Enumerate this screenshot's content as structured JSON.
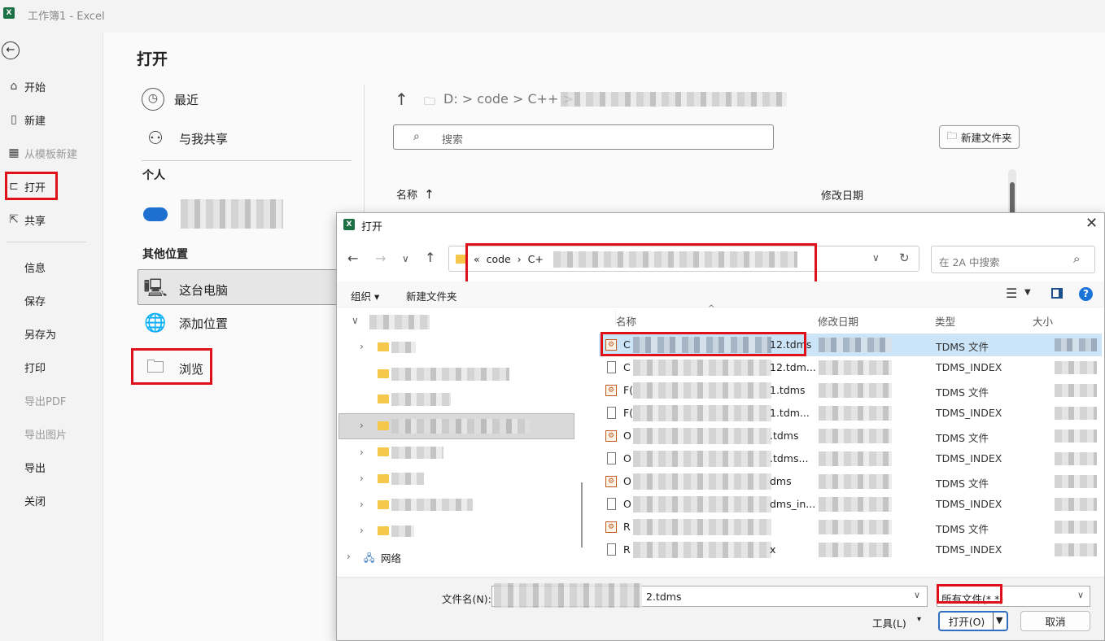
{
  "app": {
    "logo_letter": "X",
    "title": "工作簿1  -  Excel"
  },
  "rail": {
    "back_glyph": "←",
    "items": [
      {
        "label": "开始",
        "icon": "home-icon"
      },
      {
        "label": "新建",
        "icon": "new-doc-icon"
      },
      {
        "label": "从模板新建",
        "icon": "template-icon"
      },
      {
        "label": "打开",
        "icon": "open-folder-icon"
      },
      {
        "label": "共享",
        "icon": "share-icon"
      }
    ],
    "text_items": [
      "信息",
      "保存",
      "另存为",
      "打印",
      "导出PDF",
      "导出图片",
      "导出",
      "关闭"
    ]
  },
  "open_page": {
    "title": "打开",
    "recent_label": "最近",
    "shared_label": "与我共享",
    "personal_header": "个人",
    "other_header": "其他位置",
    "this_pc_label": "这台电脑",
    "add_location_label": "添加位置",
    "browse_label": "浏览",
    "path": "D: > code > C++ >",
    "search_placeholder": "搜索",
    "new_folder_label": "新建文件夹",
    "col_name": "名称",
    "col_modified": "修改日期"
  },
  "dialog": {
    "title": "打开",
    "address": "«  code  ›  C+",
    "search_placeholder": "在 2A 中搜索",
    "organize_label": "组织 ▾",
    "new_folder_label": "新建文件夹",
    "network_label": "网络",
    "columns": {
      "name": "名称",
      "modified": "修改日期",
      "type": "类型",
      "size": "大小"
    },
    "files": [
      {
        "prefix": "C",
        "suffix": "12.tdms",
        "type": "TDMS 文件",
        "kind": "tdms",
        "selected": true
      },
      {
        "prefix": "C",
        "suffix": "12.tdm...",
        "type": "TDMS_INDEX",
        "kind": "index",
        "selected": false
      },
      {
        "prefix": "F(",
        "suffix": "1.tdms",
        "type": "TDMS 文件",
        "kind": "tdms",
        "selected": false
      },
      {
        "prefix": "F(",
        "suffix": "1.tdm...",
        "type": "TDMS_INDEX",
        "kind": "index",
        "selected": false
      },
      {
        "prefix": "O",
        "suffix": ".tdms",
        "type": "TDMS 文件",
        "kind": "tdms",
        "selected": false
      },
      {
        "prefix": "O",
        "suffix": ".tdms...",
        "type": "TDMS_INDEX",
        "kind": "index",
        "selected": false
      },
      {
        "prefix": "O",
        "suffix": "dms",
        "type": "TDMS 文件",
        "kind": "tdms",
        "selected": false
      },
      {
        "prefix": "O",
        "suffix": "dms_in...",
        "type": "TDMS_INDEX",
        "kind": "index",
        "selected": false
      },
      {
        "prefix": "R",
        "suffix": "",
        "type": "TDMS 文件",
        "kind": "tdms",
        "selected": false
      },
      {
        "prefix": "R",
        "suffix": "x",
        "type": "TDMS_INDEX",
        "kind": "index",
        "selected": false
      }
    ],
    "filename_label": "文件名(N):",
    "filename_value": "2.tdms",
    "filetype_value": "所有文件(*.*)",
    "tools_label": "工具(L)",
    "open_button": "打开(O)",
    "cancel_button": "取消"
  },
  "colors": {
    "accent_red": "#e0101a",
    "excel_green": "#1d7044",
    "folder_yellow": "#f5c84c",
    "selection_blue": "#cce4f7"
  }
}
